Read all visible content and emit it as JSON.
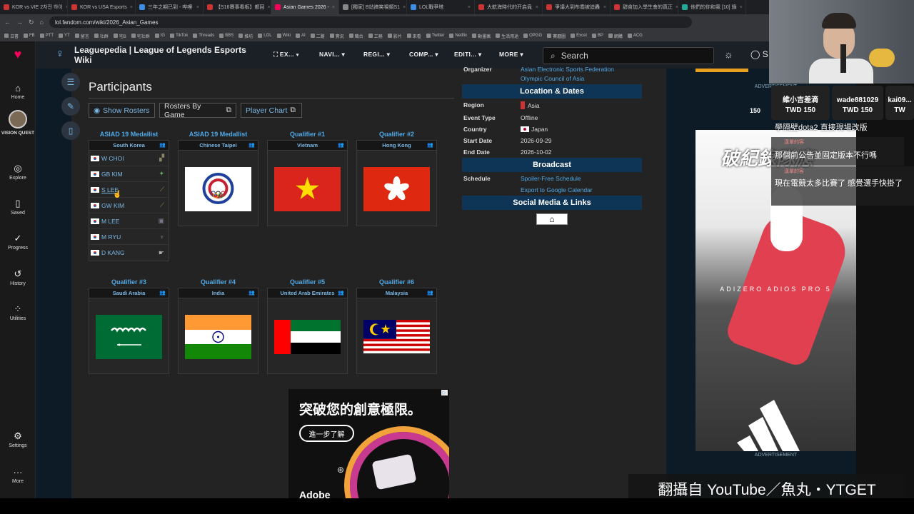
{
  "browser": {
    "tabs": [
      {
        "label": "KOR vs VIE 2차전 하이"
      },
      {
        "label": "KOR vs USA Esports"
      },
      {
        "label": "三年之期已到 - 哔哩"
      },
      {
        "label": "【S16賽事看板】都回"
      },
      {
        "label": "Asian Games 2026 -"
      },
      {
        "label": "[獨家] B站搞笑視頻S1"
      },
      {
        "label": "LOL戰爭塔"
      },
      {
        "label": "大航海時代的开启竟"
      },
      {
        "label": "爭議大到布喬被迫轟"
      },
      {
        "label": "甜食加入學生會的真正"
      },
      {
        "label": "他們的你和我 [10] 錄"
      }
    ],
    "active_tab": 4,
    "url": "lol.fandom.com/wiki/2026_Asian_Games",
    "bookmarks": [
      "日書",
      "FB",
      "PTT",
      "YT",
      "留言",
      "社群",
      "宅B",
      "宅社群",
      "IG",
      "TikTok",
      "Threads",
      "BBS",
      "推坊",
      "LOL",
      "Wiki",
      "AI",
      "二路",
      "實況",
      "職台",
      "工務",
      "影片",
      "來看",
      "Twitter",
      "Netflix",
      "動畫瘋",
      "生活用途",
      "OPGG",
      "賽曆圖",
      "Excel",
      "BP",
      "網購",
      "ACG"
    ]
  },
  "fandom_sidebar": {
    "items": [
      {
        "label": "Home",
        "icon": "home-icon"
      },
      {
        "label": "VISION QUEST",
        "icon": "avatar"
      },
      {
        "label": "Explore",
        "icon": "compass-icon"
      },
      {
        "label": "Saved",
        "icon": "bookmark-icon"
      },
      {
        "label": "Progress",
        "icon": "check-circle-icon"
      },
      {
        "label": "History",
        "icon": "history-icon"
      },
      {
        "label": "Utilities",
        "icon": "grid-plus-icon"
      },
      {
        "label": "Settings",
        "icon": "gear-icon"
      },
      {
        "label": "More",
        "icon": "dots-icon"
      }
    ]
  },
  "header": {
    "wiki_title": "Leaguepedia | League of Legends Esports Wiki",
    "nav": [
      "EX...",
      "NAVI...",
      "REGI...",
      "COMP...",
      "EDITI...",
      "MORE"
    ],
    "search_placeholder": "Search",
    "account_initial": "S"
  },
  "page": {
    "title": "Participants",
    "buttons": {
      "show_rosters": "Show Rosters",
      "rosters_by_game": "Rosters By Game",
      "player_chart": "Player Chart"
    }
  },
  "teams": [
    {
      "label": "ASIAD 19 Medallist",
      "team": "South Korea",
      "players": [
        "W CHOI",
        "GB KIM",
        "S LEE",
        "GW KIM",
        "M LEE",
        "M RYU",
        "D KANG"
      ]
    },
    {
      "label": "ASIAD 19 Medallist",
      "team": "Chinese Taipei",
      "flag": "chinese-taipei"
    },
    {
      "label": "Qualifier #1",
      "team": "Vietnam",
      "flag": "vietnam"
    },
    {
      "label": "Qualifier #2",
      "team": "Hong Kong",
      "flag": "hong-kong"
    },
    {
      "label": "Qualifier #3",
      "team": "Saudi Arabia",
      "flag": "saudi-arabia"
    },
    {
      "label": "Qualifier #4",
      "team": "India",
      "flag": "india"
    },
    {
      "label": "Qualifier #5",
      "team": "United Arab Emirates",
      "flag": "uae"
    },
    {
      "label": "Qualifier #6",
      "team": "Malaysia",
      "flag": "malaysia"
    }
  ],
  "infobox": {
    "organizer_label": "Organizer",
    "organizer_values": [
      "Asian Electronic Sports Federation",
      "Olympic Council of Asia"
    ],
    "location_header": "Location & Dates",
    "rows": [
      {
        "label": "Region",
        "value": "Asia"
      },
      {
        "label": "Event Type",
        "value": "Offline"
      },
      {
        "label": "Country",
        "value": "Japan"
      },
      {
        "label": "Start Date",
        "value": "2026-09-29"
      },
      {
        "label": "End Date",
        "value": "2026-10-02"
      }
    ],
    "broadcast_header": "Broadcast",
    "schedule_label": "Schedule",
    "schedule_links": [
      "Spoiler-Free Schedule",
      "Export to Google Calendar"
    ],
    "social_header": "Social Media & Links"
  },
  "ads": {
    "advertisement": "ADVERTISEMENT",
    "bottom_ad_headline": "突破您的創意極限。",
    "bottom_ad_button": "進一步了解",
    "bottom_ad_brand": "Adobe",
    "right_ad_text": "ADIZERO ADIOS PRO 5",
    "right_ad_overlay": "破紀錄隊應"
  },
  "stream": {
    "donations": [
      {
        "name": "維小吉差滴",
        "amount": "TWD 150"
      },
      {
        "name": "wade881029",
        "amount": "TWD 150"
      },
      {
        "name": "kai09...",
        "amount": "TW"
      }
    ],
    "donation_left_amount": "150",
    "chat": [
      {
        "user": "",
        "text": "學隔壁dota2 直接現場改版"
      },
      {
        "user": "漢單的客",
        "text": "那個前公告並固定版本不行嗎"
      },
      {
        "user": "漢單的客",
        "text": "現在電競太多比賽了 感覺選手快掛了"
      }
    ],
    "caption": "翻攝自 YouTube／魚丸・YTGET"
  },
  "colors": {
    "accent_link": "#4fa9e8",
    "infobox_header": "#0f3556",
    "fandom_logo": "#fa005a"
  }
}
